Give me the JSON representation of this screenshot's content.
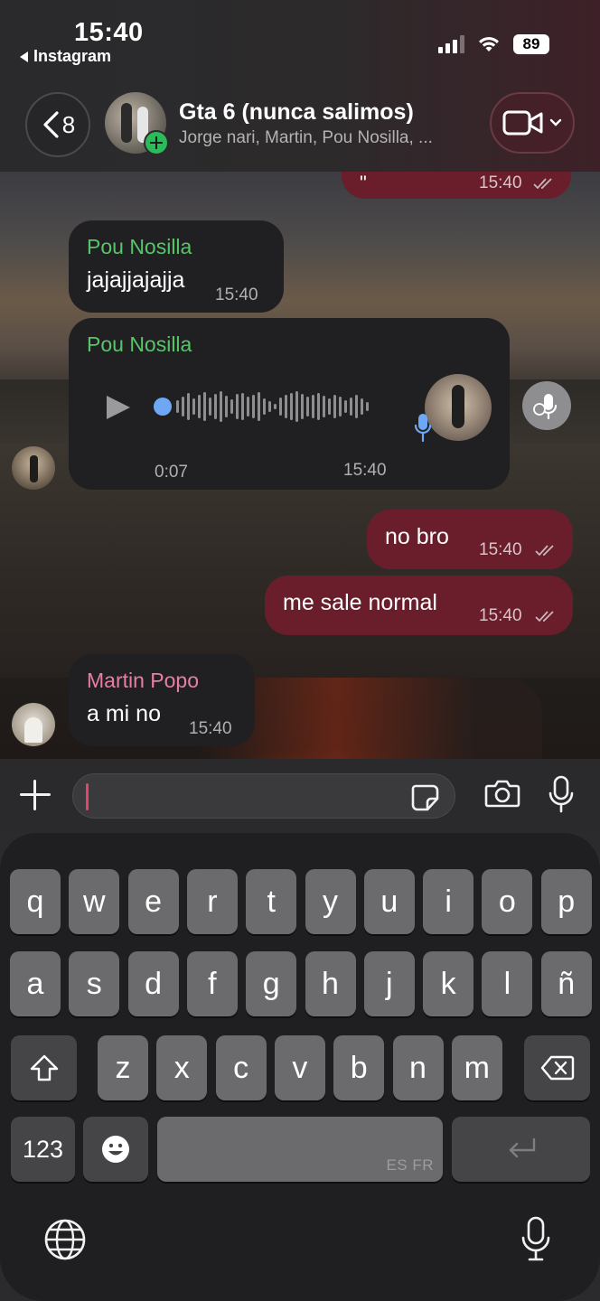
{
  "status_bar": {
    "time": "15:40",
    "back_app": "Instagram",
    "battery": "89"
  },
  "header": {
    "back_count": "8",
    "title": "Gta 6 (nunca salimos)",
    "subtitle": "Jorge nari, Martin, Pou Nosilla, ...",
    "icons": [
      "chevron-left-icon",
      "add-participant-icon",
      "video-camera-icon",
      "chevron-down-icon"
    ]
  },
  "messages": {
    "top_partial": {
      "text": "\"",
      "time": "15:40"
    },
    "m1": {
      "sender": "Pou Nosilla",
      "text": "jajajjajajja",
      "time": "15:40"
    },
    "voice": {
      "sender": "Pou Nosilla",
      "duration": "0:07",
      "time": "15:40"
    },
    "m2": {
      "text": "no bro",
      "time": "15:40"
    },
    "m3": {
      "text": "me sale normal",
      "time": "15:40"
    },
    "m4": {
      "sender": "Martin Popo",
      "text": "a mi no",
      "time": "15:40"
    }
  },
  "colors": {
    "sender_pou": "#58c56a",
    "sender_martin": "#e77fa2",
    "outgoing_bubble": "#6a1e2c",
    "incoming_bubble": "#202022",
    "voice_progress": "#6ea8f5"
  },
  "composer": {
    "value": "",
    "icons": [
      "plus-icon",
      "sticker-icon",
      "camera-icon",
      "microphone-icon"
    ]
  },
  "keyboard": {
    "row1": [
      "q",
      "w",
      "e",
      "r",
      "t",
      "y",
      "u",
      "i",
      "o",
      "p"
    ],
    "row2": [
      "a",
      "s",
      "d",
      "f",
      "g",
      "h",
      "j",
      "k",
      "l",
      "ñ"
    ],
    "row3": [
      "z",
      "x",
      "c",
      "v",
      "b",
      "n",
      "m"
    ],
    "numbers_key": "123",
    "space_languages": "ES FR"
  }
}
